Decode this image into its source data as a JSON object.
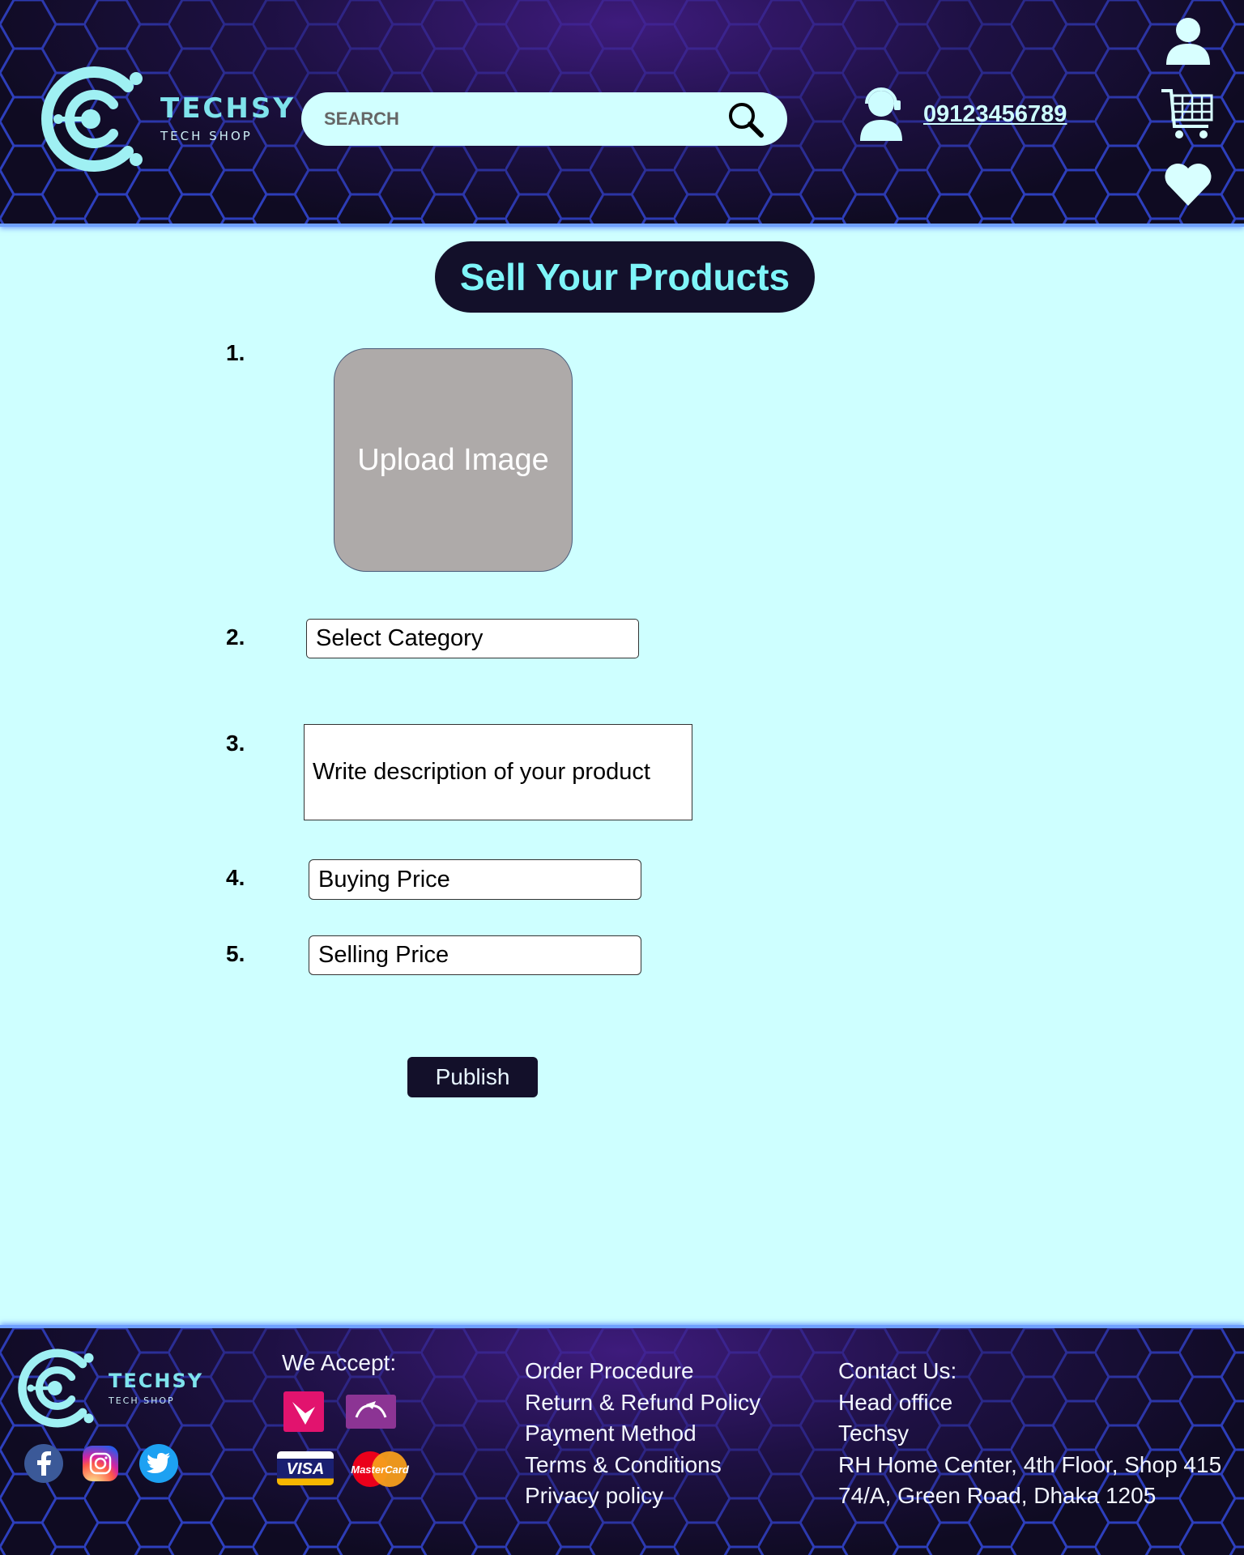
{
  "header": {
    "brand": "TECHSY",
    "tagline": "TECH SHOP",
    "search": {
      "placeholder": "SEARCH"
    },
    "phone": "09123456789",
    "icons": [
      "user-icon",
      "cart-icon",
      "heart-icon",
      "search-icon",
      "support-icon"
    ]
  },
  "main": {
    "title": "Sell Your Products",
    "steps": [
      "1.",
      "2.",
      "3.",
      "4.",
      "5."
    ],
    "upload_label": "Upload Image",
    "category_placeholder": "Select Category",
    "description_placeholder": "Write description of your product",
    "buying_placeholder": "Buying Price",
    "selling_placeholder": "Selling Price",
    "publish_label": "Publish"
  },
  "footer": {
    "brand": "TECHSY",
    "tagline": "TECH SHOP",
    "accept_title": "We Accept:",
    "payment_methods": [
      "bkash",
      "Rocket",
      "VISA",
      "MasterCard"
    ],
    "links": [
      "Order Procedure",
      "Return & Refund Policy",
      "Payment Method",
      "Terms & Conditions",
      "Privacy policy"
    ],
    "contact": [
      "Contact Us:",
      "Head office",
      "Techsy",
      "RH Home Center, 4th Floor, Shop 415",
      "74/A, Green Road, Dhaka 1205"
    ],
    "social": [
      "facebook-icon",
      "instagram-icon",
      "twitter-icon"
    ]
  },
  "colors": {
    "page_bg": "#ceffff",
    "dark": "#13102a",
    "accent_cyan": "#7ff5f9",
    "hex_line": "#3a56ff"
  }
}
